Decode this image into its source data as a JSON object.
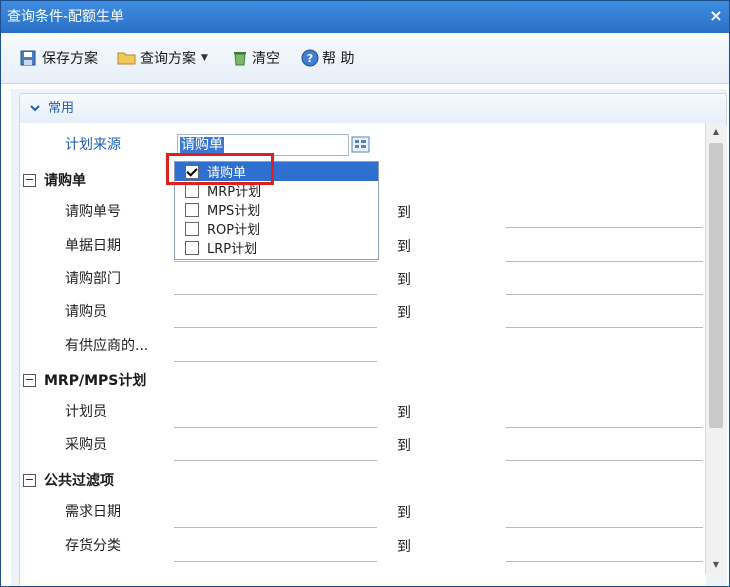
{
  "window": {
    "title": "查询条件-配额生单",
    "close": "×"
  },
  "toolbar": {
    "save_scheme": "保存方案",
    "query_scheme": "查询方案",
    "clear": "清空",
    "help": "帮 助"
  },
  "section": {
    "title": "常用"
  },
  "source": {
    "label": "计划来源",
    "value": "请购单",
    "options": [
      {
        "label": "请购单",
        "checked": true
      },
      {
        "label": "MRP计划",
        "checked": false
      },
      {
        "label": "MPS计划",
        "checked": false
      },
      {
        "label": "ROP计划",
        "checked": false
      },
      {
        "label": "LRP计划",
        "checked": false
      }
    ]
  },
  "groups": {
    "requisition": {
      "title": "请购单",
      "fields": {
        "number": "请购单号",
        "date": "单据日期",
        "dept": "请购部门",
        "person": "请购员",
        "has_supplier": "有供应商的..."
      }
    },
    "mrp": {
      "title": "MRP/MPS计划",
      "fields": {
        "planner": "计划员",
        "buyer": "采购员"
      }
    },
    "common": {
      "title": "公共过滤项",
      "fields": {
        "need_date": "需求日期",
        "inv_class": "存货分类"
      }
    }
  },
  "to_label": "到"
}
